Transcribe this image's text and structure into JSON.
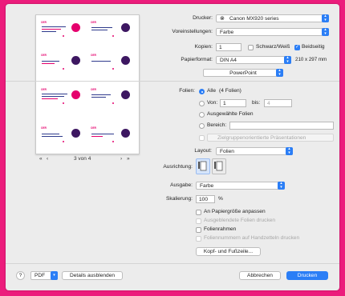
{
  "dialog": {
    "printer_label": "Drucker:",
    "printer_value": "Canon MX920 series",
    "presets_label": "Voreinstellungen:",
    "presets_value": "Farbe",
    "copies_label": "Kopien:",
    "copies_value": "1",
    "bw_label": "Schwarz/Weiß",
    "duplex_label": "Beidseitig",
    "paper_label": "Papierformat:",
    "paper_value": "DIN A4",
    "paper_size_text": "210 x 297 mm",
    "app_section_value": "PowerPoint",
    "slides_label": "Folien:",
    "slides_all_label": "Alle",
    "slides_all_count": "(4 Folien)",
    "from_label": "Von:",
    "from_value": "1",
    "to_label": "bis:",
    "to_value": "4",
    "selected_slides_label": "Ausgewählte Folien",
    "range_label": "Bereich:",
    "custom_show_placeholder": "Zielgruppenorientierte Präsentationen",
    "layout_label": "Layout:",
    "layout_value": "Folien",
    "orientation_label": "Ausrichtung:",
    "output_label": "Ausgabe:",
    "output_value": "Farbe",
    "scaling_label": "Skalierung:",
    "scaling_value": "100",
    "scaling_unit": "%",
    "fit_to_paper_label": "An Papiergröße anpassen",
    "hidden_slides_label": "Ausgeblendete Folien drucken",
    "frame_slides_label": "Folienrahmen",
    "slide_numbers_label": "Foliennummern auf Handzetteln drucken",
    "header_footer_button": "Kopf- und Fußzeile..."
  },
  "preview": {
    "page_indicator": "3 von 4",
    "first_icon": "«",
    "prev_icon": "‹",
    "next_icon": "›",
    "last_icon": "»",
    "slide_logo": "OER"
  },
  "footer": {
    "help_label": "?",
    "pdf_label": "PDF",
    "hide_details_button": "Details ausblenden",
    "cancel_button": "Abbrechen",
    "print_button": "Drucken"
  },
  "colors": {
    "background": "#ec1c7c",
    "accent": "#2b7ef6",
    "slide_pink": "#e5006d",
    "slide_purple": "#3d1761"
  }
}
